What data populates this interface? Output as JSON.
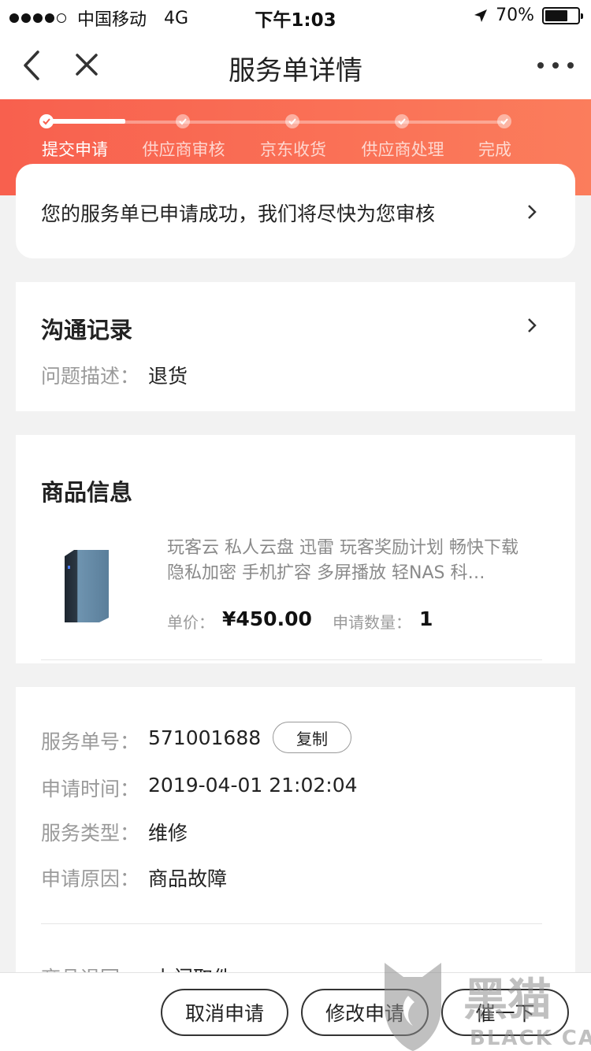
{
  "status_bar": {
    "carrier": "中国移动",
    "network": "4G",
    "time": "下午1:03",
    "battery": "70%",
    "battery_level": 0.7
  },
  "nav": {
    "title": "服务单详情"
  },
  "progress": {
    "steps": [
      "提交申请",
      "供应商审核",
      "京东收货",
      "供应商处理",
      "完成"
    ],
    "current_step": 1
  },
  "notice": {
    "text": "您的服务单已申请成功，我们将尽快为您审核"
  },
  "communication": {
    "title": "沟通记录",
    "problem_label": "问题描述：",
    "problem_value": "退货"
  },
  "goods": {
    "title": "商品信息",
    "name": "玩客云 私人云盘 迅雷 玩客奖励计划 畅快下载 隐私加密 手机扩容 多屏播放 轻NAS 科…",
    "price_label": "单价：",
    "price": "¥450.00",
    "qty_label": "申请数量：",
    "qty": "1"
  },
  "service_info": {
    "number_label": "服务单号：",
    "number": "571001688",
    "copy_label": "复制",
    "time_label": "申请时间：",
    "time": "2019-04-01 21:02:04",
    "type_label": "服务类型：",
    "type": "维修",
    "reason_label": "申请原因：",
    "reason": "商品故障",
    "return_label": "商品退回：",
    "return_value": "上门取件"
  },
  "actions": {
    "cancel": "取消申请",
    "modify": "修改申请",
    "urge": "催一下"
  },
  "watermark": {
    "text_cn": "黑猫",
    "text_en": "BLACK CAT"
  },
  "colors": {
    "accent_start": "#f8604e",
    "accent_end": "#fb7d5c"
  }
}
